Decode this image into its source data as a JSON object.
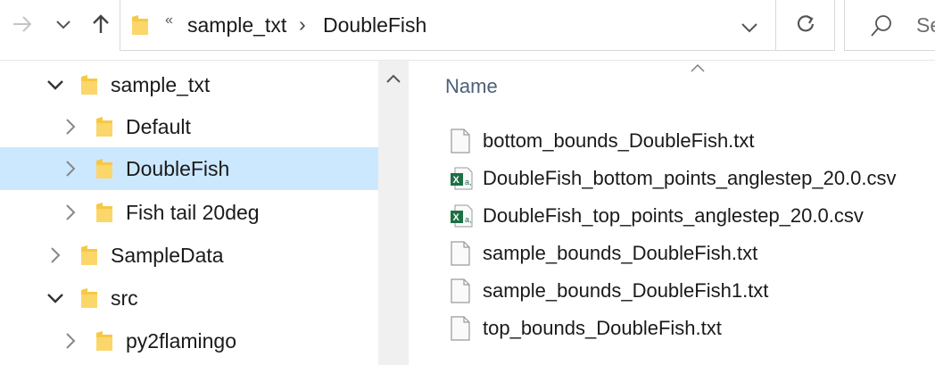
{
  "toolbar": {
    "forward_icon": "arrow-right-icon",
    "recent_icon": "chevron-down-icon",
    "up_icon": "arrow-up-icon"
  },
  "address": {
    "overflow": "«",
    "crumbs": [
      "sample_txt",
      "DoubleFish"
    ],
    "separator": "›"
  },
  "search": {
    "placeholder": "Se"
  },
  "nav": {
    "items": [
      {
        "label": "sample_txt",
        "expanded": true
      },
      {
        "label": "Default",
        "expanded": false
      },
      {
        "label": "DoubleFish",
        "expanded": false,
        "selected": true
      },
      {
        "label": "Fish tail 20deg",
        "expanded": false
      },
      {
        "label": "SampleData",
        "expanded": false
      },
      {
        "label": "src",
        "expanded": true
      },
      {
        "label": "py2flamingo",
        "expanded": false
      }
    ]
  },
  "content": {
    "column_name": "Name",
    "files": [
      {
        "name": "bottom_bounds_DoubleFish.txt",
        "icon": "text-file-icon"
      },
      {
        "name": "DoubleFish_bottom_points_anglestep_20.0.csv",
        "icon": "excel-csv-icon"
      },
      {
        "name": "DoubleFish_top_points_anglestep_20.0.csv",
        "icon": "excel-csv-icon"
      },
      {
        "name": "sample_bounds_DoubleFish.txt",
        "icon": "text-file-icon"
      },
      {
        "name": "sample_bounds_DoubleFish1.txt",
        "icon": "text-file-icon"
      },
      {
        "name": "top_bounds_DoubleFish.txt",
        "icon": "text-file-icon"
      }
    ]
  },
  "colors": {
    "selection": "#cce8ff",
    "folder": "#f7c842",
    "excel": "#1d7044",
    "header_text": "#4c607a"
  }
}
